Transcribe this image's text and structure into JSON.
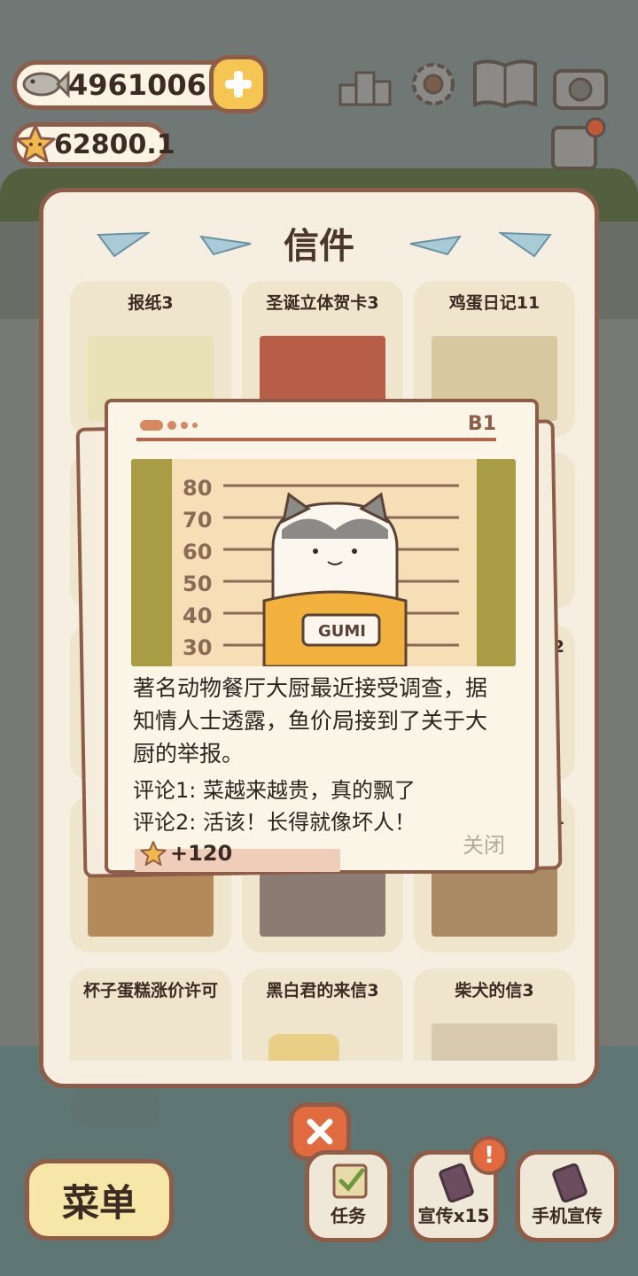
{
  "header": {
    "fish_amount": "4961006",
    "star_amount": "62800.1"
  },
  "letters_panel": {
    "title": "信件",
    "cards": [
      {
        "label": "报纸3"
      },
      {
        "label": "圣诞立体贺卡3"
      },
      {
        "label": "鸡蛋日记11"
      },
      {
        "label": "杯子蛋糕涨价许可"
      },
      {
        "label": "黑白君的来信3"
      },
      {
        "label": "柴犬的信3"
      }
    ],
    "partial_labels": [
      "2",
      "1"
    ]
  },
  "newspaper": {
    "page_number": "B1",
    "chart_marks": [
      "80",
      "70",
      "60",
      "50",
      "40",
      "30"
    ],
    "name_plate": "GUMI",
    "article_lines": [
      "著名动物餐厅大厨最近接受调查，据",
      "知情人士透露，鱼价局接到了关于大",
      "厨的举报。"
    ],
    "comment_1": "评论1: 菜越来越贵，真的飘了",
    "comment_2": "评论2: 活该！长得就像坏人！",
    "reward": "+120",
    "close_label": "关闭"
  },
  "bottom_bar": {
    "menu_label": "菜单",
    "task_label": "任务",
    "promote_label": "宣传x15",
    "phone_promote_label": "手机宣传",
    "alert_badge": "!"
  },
  "colors": {
    "border_brown": "#8e5d49",
    "panel_bg": "#f6efe1",
    "card_bg": "#efe5cd",
    "accent_orange": "#e26a3f",
    "gold": "#f5c651"
  }
}
